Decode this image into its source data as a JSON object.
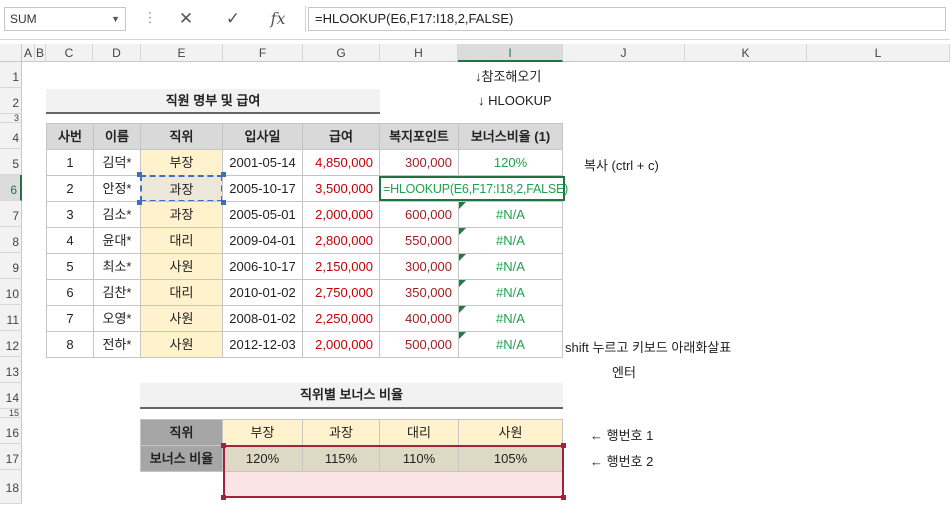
{
  "formula_bar": {
    "name_box": "SUM",
    "cancel_icon": "✕",
    "enter_icon": "✓",
    "fx_label": "fx",
    "formula": "=HLOOKUP(E6,F17:I18,2,FALSE)"
  },
  "columns": [
    "A",
    "B",
    "C",
    "D",
    "E",
    "F",
    "G",
    "H",
    "I",
    "J",
    "K",
    "L"
  ],
  "rows": [
    "1",
    "2",
    "3",
    "4",
    "5",
    "6",
    "7",
    "8",
    "9",
    "10",
    "11",
    "12",
    "13",
    "14",
    "15",
    "16",
    "17",
    "18"
  ],
  "title": "직원 명부 및 급여",
  "arrow_note": "↓참조해오기",
  "hlookup_note": "↓ HLOOKUP",
  "table": {
    "headers": [
      "사번",
      "이름",
      "직위",
      "입사일",
      "급여",
      "복지포인트",
      "보너스비율 (1)"
    ],
    "rows": [
      [
        "1",
        "김덕*",
        "부장",
        "2001-05-14",
        "4,850,000",
        "300,000",
        "120%"
      ],
      [
        "2",
        "안정*",
        "과장",
        "2005-10-17",
        "3,500,000",
        "",
        "=HLOOKUP(E6,F17:I18,2,FALSE)"
      ],
      [
        "3",
        "김소*",
        "과장",
        "2005-05-01",
        "2,000,000",
        "600,000",
        "#N/A"
      ],
      [
        "4",
        "윤대*",
        "대리",
        "2009-04-01",
        "2,800,000",
        "550,000",
        "#N/A"
      ],
      [
        "5",
        "최소*",
        "사원",
        "2006-10-17",
        "2,150,000",
        "300,000",
        "#N/A"
      ],
      [
        "6",
        "김찬*",
        "대리",
        "2010-01-02",
        "2,750,000",
        "350,000",
        "#N/A"
      ],
      [
        "7",
        "오영*",
        "사원",
        "2008-01-02",
        "2,250,000",
        "400,000",
        "#N/A"
      ],
      [
        "8",
        "전하*",
        "사원",
        "2012-12-03",
        "2,000,000",
        "500,000",
        "#N/A"
      ]
    ]
  },
  "copy_note": "복사 (ctrl + c)",
  "shift_note": "shift 누르고 키보드 아래화살표",
  "enter_note": "엔터",
  "bonus_title": "직위별 보너스 비율",
  "bonus_table": {
    "row1_label": "직위",
    "row1": [
      "부장",
      "과장",
      "대리",
      "사원"
    ],
    "row2_label": "보너스 비율",
    "row2": [
      "120%",
      "115%",
      "110%",
      "105%"
    ]
  },
  "row_note_1": "← 행번호 1",
  "row_note_2": "← 행번호 2",
  "colors": {
    "accent_green": "#217346",
    "value_red": "#c00000",
    "result_green": "#22a04b",
    "highlight_yellow": "#fff2cc",
    "selection_red": "#a3213c"
  }
}
